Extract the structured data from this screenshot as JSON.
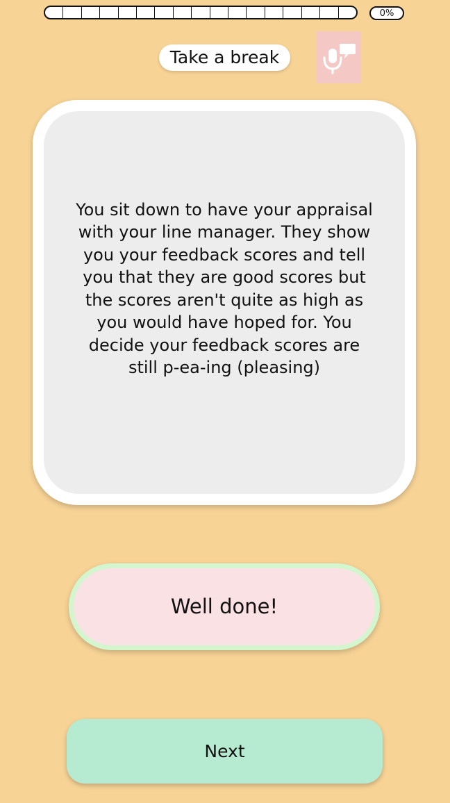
{
  "progress": {
    "segments": 17,
    "value_fraction": 0,
    "percent_label": "0%",
    "fill_color": "#b7ecd1"
  },
  "header": {
    "break_label": "Take a break",
    "voice_icon": "microphone-speech-icon"
  },
  "card": {
    "text": "You sit down to have your appraisal\nwith your line manager. They show\nyou your feedback scores and tell\nyou that they are good scores but\nthe scores aren't quite as high as\nyou would have hoped for.  You\ndecide your feedback scores are\nstill p-ea-ing (pleasing)"
  },
  "feedback": {
    "label": "Well done!"
  },
  "footer": {
    "next_label": "Next"
  },
  "colors": {
    "background": "#f7d396",
    "card": "#ededed",
    "feedback_fill": "#f9e1e4",
    "feedback_border": "#d4f6cf",
    "next_button": "#b6ebd2",
    "voice_button": "#f4c9c5"
  }
}
